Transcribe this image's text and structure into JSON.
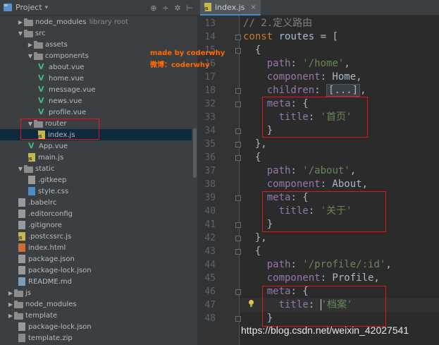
{
  "project_panel": {
    "title": "Project",
    "tools": [
      "⊕",
      "÷",
      "✲",
      "⊢"
    ],
    "tree": [
      {
        "label": "node_modules",
        "suffix": "library root",
        "type": "folder",
        "arrow": "▶"
      },
      {
        "label": "src",
        "type": "folder",
        "arrow": "▼"
      },
      {
        "label": "assets",
        "type": "folder",
        "arrow": "▶"
      },
      {
        "label": "components",
        "type": "folder",
        "arrow": "▼"
      },
      {
        "label": "about.vue",
        "type": "vue"
      },
      {
        "label": "home.vue",
        "type": "vue"
      },
      {
        "label": "message.vue",
        "type": "vue"
      },
      {
        "label": "news.vue",
        "type": "vue"
      },
      {
        "label": "profile.vue",
        "type": "vue"
      },
      {
        "label": "router",
        "type": "folder",
        "arrow": "▼"
      },
      {
        "label": "index.js",
        "type": "js"
      },
      {
        "label": "App.vue",
        "type": "vue"
      },
      {
        "label": "main.js",
        "type": "js"
      },
      {
        "label": "static",
        "type": "folder",
        "arrow": "▼"
      },
      {
        "label": ".gitkeep",
        "type": "gen"
      },
      {
        "label": "style.css",
        "type": "css"
      },
      {
        "label": ".babelrc",
        "type": "gen"
      },
      {
        "label": ".editorconfig",
        "type": "gen"
      },
      {
        "label": ".gitignore",
        "type": "gen"
      },
      {
        "label": ".postcssrc.js",
        "type": "js"
      },
      {
        "label": "index.html",
        "type": "html"
      },
      {
        "label": "package.json",
        "type": "gen"
      },
      {
        "label": "package-lock.json",
        "type": "gen"
      },
      {
        "label": "README.md",
        "type": "md"
      },
      {
        "label": "js",
        "type": "folder",
        "arrow": "▶"
      },
      {
        "label": "node_modules",
        "type": "folder",
        "arrow": "▶"
      },
      {
        "label": "template",
        "type": "folder",
        "arrow": "▶"
      },
      {
        "label": "package-lock.json",
        "type": "gen"
      },
      {
        "label": "template.zip",
        "type": "zip"
      }
    ]
  },
  "editor": {
    "tab_label": "index.js",
    "tab_close": "×",
    "fold_placeholder": "[...]",
    "line_numbers": [
      "13",
      "14",
      "15",
      "16",
      "17",
      "18",
      "32",
      "33",
      "34",
      "35",
      "36",
      "37",
      "38",
      "39",
      "40",
      "41",
      "42",
      "43",
      "44",
      "45",
      "46",
      "47",
      "48"
    ],
    "lines": [
      {
        "parts": [
          {
            "t": "// 2.定义路由",
            "c": "cm"
          }
        ]
      },
      {
        "parts": [
          {
            "t": "const",
            "c": "kw"
          },
          {
            "t": " routes = ["
          }
        ]
      },
      {
        "parts": [
          {
            "t": "  {"
          }
        ]
      },
      {
        "parts": [
          {
            "t": "    path",
            "c": "prop"
          },
          {
            "t": ": "
          },
          {
            "t": "'/home'",
            "c": "str"
          },
          {
            "t": ","
          }
        ]
      },
      {
        "parts": [
          {
            "t": "    component",
            "c": "prop"
          },
          {
            "t": ": Home,"
          }
        ]
      },
      {
        "parts": [
          {
            "t": "    children",
            "c": "prop"
          },
          {
            "t": ": "
          },
          {
            "t": "[...]",
            "c": "fold-ph"
          },
          {
            "t": ","
          }
        ]
      },
      {
        "parts": [
          {
            "t": "    meta",
            "c": "prop"
          },
          {
            "t": ": {"
          }
        ]
      },
      {
        "parts": [
          {
            "t": "      title",
            "c": "prop"
          },
          {
            "t": ": "
          },
          {
            "t": "'首页'",
            "c": "str"
          }
        ]
      },
      {
        "parts": [
          {
            "t": "    }"
          }
        ]
      },
      {
        "parts": [
          {
            "t": "  },"
          }
        ]
      },
      {
        "parts": [
          {
            "t": "  {"
          }
        ]
      },
      {
        "parts": [
          {
            "t": "    path",
            "c": "prop"
          },
          {
            "t": ": "
          },
          {
            "t": "'/about'",
            "c": "str"
          },
          {
            "t": ","
          }
        ]
      },
      {
        "parts": [
          {
            "t": "    component",
            "c": "prop"
          },
          {
            "t": ": About,"
          }
        ]
      },
      {
        "parts": [
          {
            "t": "    meta",
            "c": "prop"
          },
          {
            "t": ": {"
          }
        ]
      },
      {
        "parts": [
          {
            "t": "      title",
            "c": "prop"
          },
          {
            "t": ": "
          },
          {
            "t": "'关于'",
            "c": "str"
          }
        ]
      },
      {
        "parts": [
          {
            "t": "    }"
          }
        ]
      },
      {
        "parts": [
          {
            "t": "  },"
          }
        ]
      },
      {
        "parts": [
          {
            "t": "  {"
          }
        ]
      },
      {
        "parts": [
          {
            "t": "    path",
            "c": "prop"
          },
          {
            "t": ": "
          },
          {
            "t": "'/profile/:id'",
            "c": "str"
          },
          {
            "t": ","
          }
        ]
      },
      {
        "parts": [
          {
            "t": "    component",
            "c": "prop"
          },
          {
            "t": ": Profile,"
          }
        ]
      },
      {
        "parts": [
          {
            "t": "    meta",
            "c": "prop"
          },
          {
            "t": ": {"
          }
        ]
      },
      {
        "parts": [
          {
            "t": "      title",
            "c": "prop"
          },
          {
            "t": ": "
          },
          {
            "t": "'档案'",
            "c": "str"
          }
        ]
      },
      {
        "parts": [
          {
            "t": "    }"
          }
        ]
      }
    ]
  },
  "annotations": {
    "made_by": "made by coderwhy",
    "weibo": "微博：coderwhy",
    "watermark": "https://blog.csdn.net/weixin_42027541"
  },
  "colors": {
    "keyword": "#cc7832",
    "property": "#9876aa",
    "string": "#6a8759",
    "comment": "#808080",
    "highlight_box": "#e0181b"
  }
}
